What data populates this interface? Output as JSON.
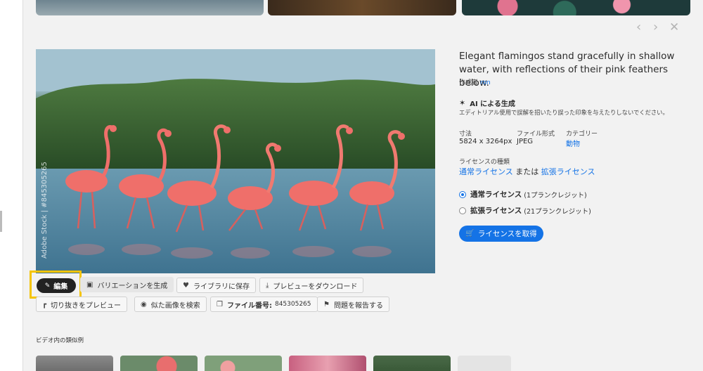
{
  "top_nav": {
    "prev_icon": "chevron-left-icon",
    "next_icon": "chevron-right-icon",
    "close_icon": "close-icon"
  },
  "image": {
    "watermark": "Adobe Stock | #845305265"
  },
  "actions": {
    "edit": "編集",
    "variation": "バリエーションを生成",
    "save_library": "ライブラリに保存",
    "download_preview": "プレビューをダウンロード",
    "crop_preview": "切り抜きをプレビュー",
    "find_similar": "似た画像を検索",
    "file_number_label": "ファイル番号:",
    "file_number": "845305265",
    "report": "問題を報告する"
  },
  "details": {
    "description": "Elegant flamingos stand gracefully in shallow water, with reflections of their pink feathers below.",
    "creator_label": "作成者",
    "creator_name": "ron",
    "ai_title": "AI による生成",
    "ai_note": "エディトリアル使用で誤解を招いたり誤った印象を与えたりしないでください。",
    "size_label": "寸法",
    "size_value": "5824 x 3264px",
    "format_label": "ファイル形式",
    "format_value": "JPEG",
    "category_label": "カテゴリー",
    "category_value": "動物",
    "license_type_label": "ライセンスの種類",
    "standard_license": "通常ライセンス",
    "or_text": "または",
    "extended_license": "拡張ライセンス"
  },
  "license_options": [
    {
      "label": "通常ライセンス",
      "credits": "(1プランクレジット)",
      "selected": true
    },
    {
      "label": "拡張ライセンス",
      "credits": "(21プランクレジット)",
      "selected": false
    }
  ],
  "license_button": "ライセンスを取得",
  "similar_section": {
    "title": "ビデオ内の類似例"
  },
  "colors": {
    "accent": "#1473e6",
    "highlight": "#f5c400"
  }
}
